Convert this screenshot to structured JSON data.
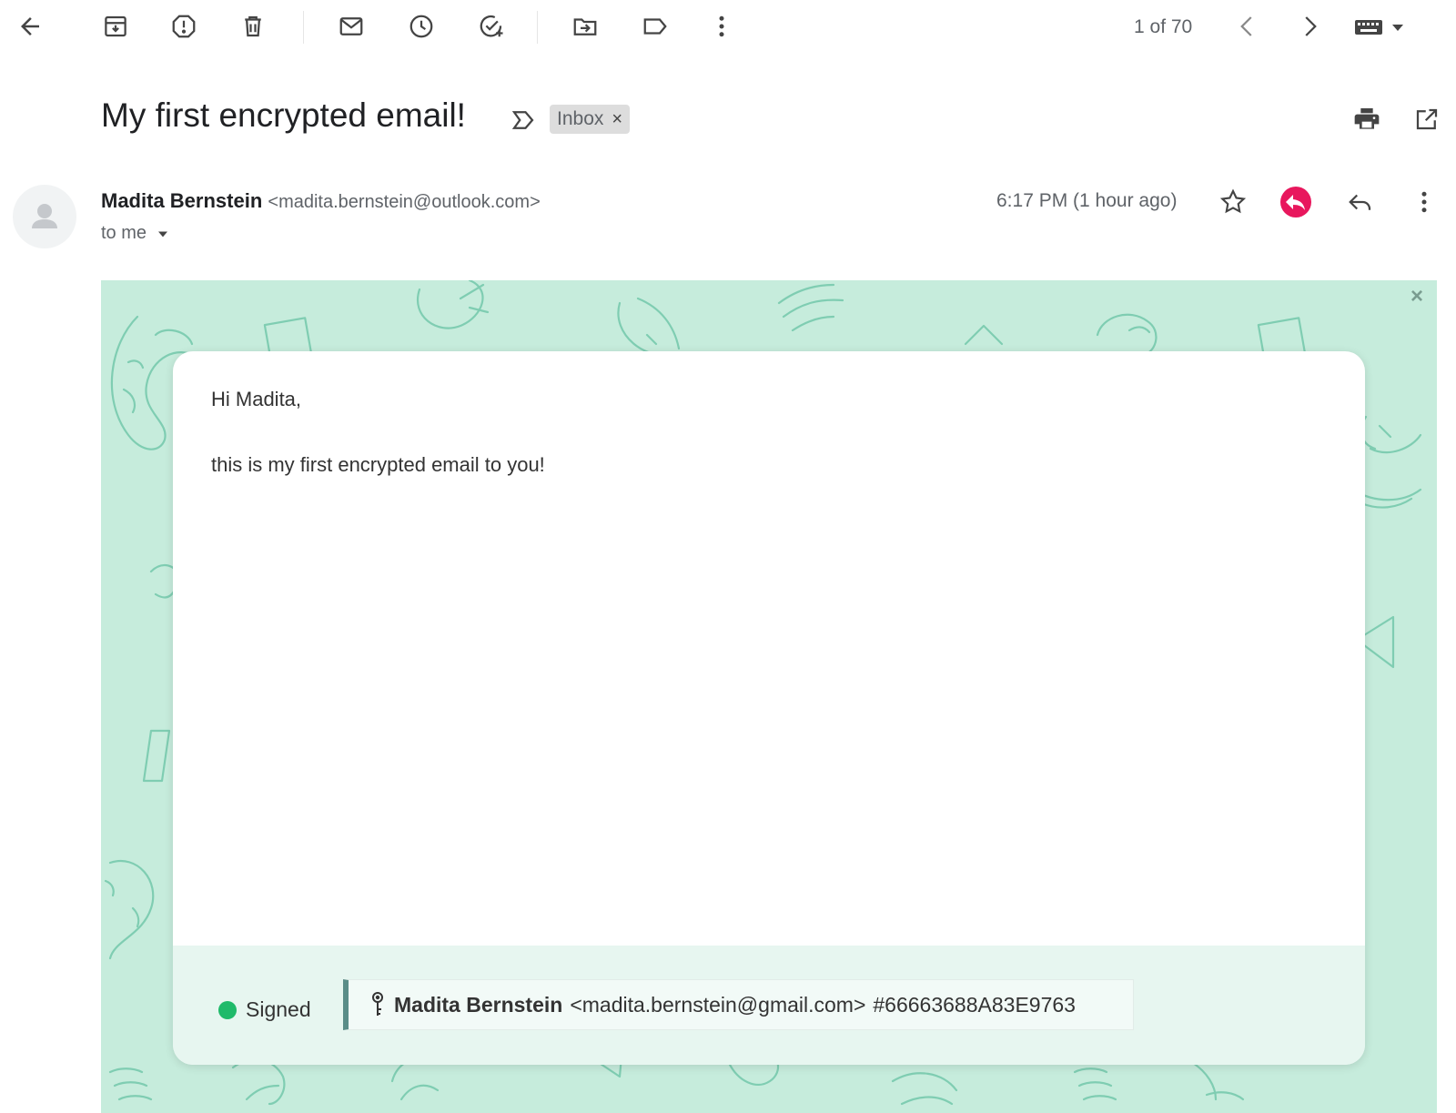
{
  "toolbar": {
    "counter": "1 of 70",
    "icons": [
      "back-arrow-icon",
      "archive-icon",
      "report-spam-icon",
      "delete-icon",
      "mark-unread-icon",
      "snooze-icon",
      "add-to-tasks-icon",
      "move-to-icon",
      "label-icon",
      "more-vert-icon",
      "newer-icon",
      "older-icon",
      "keyboard-icon",
      "dropdown-icon"
    ]
  },
  "email": {
    "subject": "My first encrypted email!",
    "label_chip": "Inbox",
    "label_chip_close": "×",
    "sender_name": "Madita Bernstein",
    "sender_email": "<madita.bernstein@outlook.com>",
    "recipient": "to me",
    "timestamp": "6:17 PM (1 hour ago)"
  },
  "encrypted_view": {
    "close": "×",
    "body": [
      "Hi Madita,",
      "this is my first encrypted email to you!"
    ],
    "signature_status": "Signed",
    "signer_name": "Madita Bernstein",
    "signer_email": "<madita.bernstein@gmail.com>",
    "key_id": "#66663688A83E9763"
  },
  "colors": {
    "pattern_background": "#c6ecdc",
    "pattern_lines": "#7fcdb2",
    "signed_dot": "#1fba6a",
    "reply_badge": "#e8175d",
    "signer_accent": "#5b8d88"
  }
}
